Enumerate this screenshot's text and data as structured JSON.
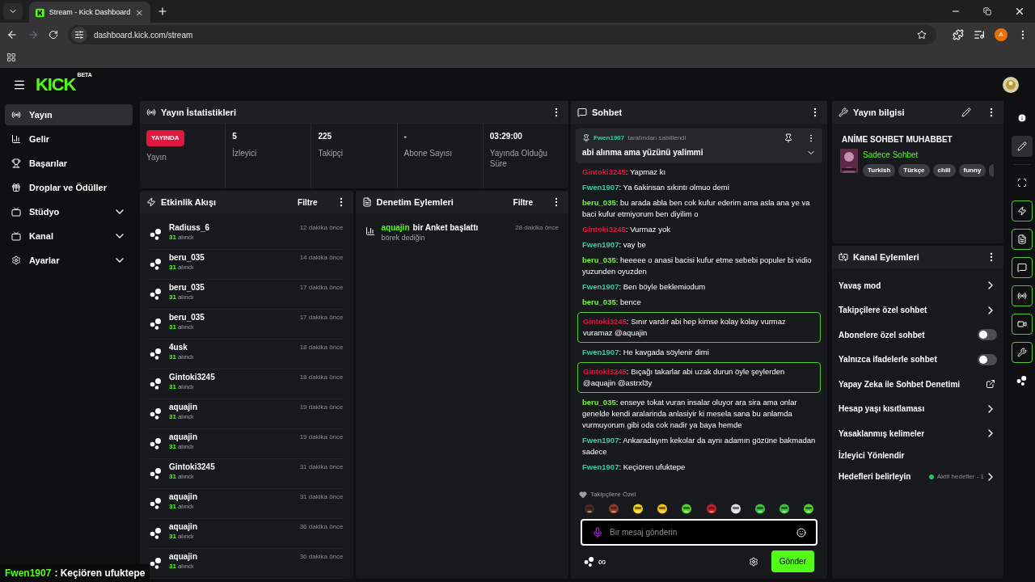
{
  "browser": {
    "tab_title": "Stream - Kick Dashboard",
    "url": "dashboard.kick.com/stream",
    "profile_initial": "A"
  },
  "header": {
    "logo": "KICK",
    "logo_badge": "BETA"
  },
  "sidebar": {
    "items": [
      {
        "label": "Yayın",
        "selected": true,
        "kind": "link"
      },
      {
        "label": "Gelir",
        "selected": false,
        "kind": "link"
      },
      {
        "label": "Başarılar",
        "selected": false,
        "kind": "link"
      },
      {
        "label": "Droplar ve Ödüller",
        "selected": false,
        "kind": "link"
      },
      {
        "label": "Stüdyo",
        "selected": false,
        "kind": "group"
      },
      {
        "label": "Kanal",
        "selected": false,
        "kind": "group"
      },
      {
        "label": "Ayarlar",
        "selected": false,
        "kind": "group"
      }
    ]
  },
  "stats": {
    "title": "Yayın İstatistikleri",
    "items": [
      {
        "kind": "badge",
        "value": "YAYINDA",
        "label": "Yayın"
      },
      {
        "kind": "value",
        "value": "5",
        "label": "İzleyici"
      },
      {
        "kind": "value",
        "value": "225",
        "label": "Takipçi"
      },
      {
        "kind": "value",
        "value": "-",
        "label": "Abone Sayısı"
      },
      {
        "kind": "value",
        "value": "03:29:00",
        "label": "Yayında Olduğu Süre"
      }
    ]
  },
  "events": {
    "title": "Etkinlik Akışı",
    "filter": "Filtre",
    "items": [
      {
        "name": "Radiuss_6",
        "amount": "31",
        "action": "alındı",
        "time": "12 dakika önce"
      },
      {
        "name": "beru_035",
        "amount": "31",
        "action": "alındı",
        "time": "14 dakika önce"
      },
      {
        "name": "beru_035",
        "amount": "31",
        "action": "alındı",
        "time": "17 dakika önce"
      },
      {
        "name": "beru_035",
        "amount": "31",
        "action": "alındı",
        "time": "17 dakika önce"
      },
      {
        "name": "4usk",
        "amount": "31",
        "action": "alındı",
        "time": "18 dakika önce"
      },
      {
        "name": "Gintoki3245",
        "amount": "31",
        "action": "alındı",
        "time": "18 dakika önce"
      },
      {
        "name": "aquajin",
        "amount": "31",
        "action": "alındı",
        "time": "19 dakika önce"
      },
      {
        "name": "aquajin",
        "amount": "31",
        "action": "alındı",
        "time": "19 dakika önce"
      },
      {
        "name": "Gintoki3245",
        "amount": "31",
        "action": "alındı",
        "time": "31 dakika önce"
      },
      {
        "name": "aquajin",
        "amount": "31",
        "action": "alındı",
        "time": "31 dakika önce"
      },
      {
        "name": "aquajin",
        "amount": "31",
        "action": "alındı",
        "time": "36 dakika önce"
      },
      {
        "name": "aquajin",
        "amount": "31",
        "action": "alındı",
        "time": "36 dakika önce"
      }
    ]
  },
  "moderation": {
    "title": "Denetim Eylemleri",
    "filter": "Filtre",
    "items": [
      {
        "user": "aquajin",
        "action": "bir Anket başlattı",
        "detail": "börek dediğin",
        "time": "28 dakika önce"
      }
    ]
  },
  "chat": {
    "title": "Sohbet",
    "pinned": {
      "user": "Fwen1907",
      "by": "tarafından sabitlendi",
      "message": "abi alınma ama yüzünü yalimmi"
    },
    "messages": [
      {
        "user": "Gintoki3245",
        "color": "#e0173f",
        "separator": ":",
        "text": "Yapmaz kı",
        "highlighted": false
      },
      {
        "user": "Fwen1907",
        "color": "#3ec9a7",
        "separator": ":",
        "text": "Ya 6akinsan sıkıntı olmuo demi",
        "highlighted": false
      },
      {
        "user": "beru_035",
        "color": "#72f53a",
        "separator": ":",
        "text": "bu arada abla ben cok kufur ederim ama asla ana ye va baci kufur etmiyorum ben diyilim o",
        "highlighted": false
      },
      {
        "user": "Gintoki3245",
        "color": "#e0173f",
        "separator": ":",
        "text": "Vurmaz yok",
        "highlighted": false
      },
      {
        "user": "Fwen1907",
        "color": "#3ec9a7",
        "separator": ":",
        "text": "vay be",
        "highlighted": false
      },
      {
        "user": "beru_035",
        "color": "#72f53a",
        "separator": ":",
        "text": "heeeee o anasi bacisi kufur etme sebebi populer bi vidio yuzunden oyuzden",
        "highlighted": false
      },
      {
        "user": "Fwen1907",
        "color": "#3ec9a7",
        "separator": ":",
        "text": "Ben böyle beklemiodum",
        "highlighted": false
      },
      {
        "user": "beru_035",
        "color": "#72f53a",
        "separator": ":",
        "text": "bence",
        "highlighted": false
      },
      {
        "user": "Gintoki3245",
        "color": "#e0173f",
        "separator": ":",
        "text": "Sınır vardır abi hep kimse kolay kolay vurmaz vuramaz @aquajin",
        "highlighted": true
      },
      {
        "user": "Fwen1907",
        "color": "#3ec9a7",
        "separator": ":",
        "text": "He kavgada söylenir dimi",
        "highlighted": false
      },
      {
        "user": "Gintoki3245",
        "color": "#e0173f",
        "separator": ":",
        "text": "Bıçağı takarlar abi uzak durun öyle şeylerden @aquajin @astrxl3y",
        "highlighted": true
      },
      {
        "user": "beru_035",
        "color": "#72f53a",
        "separator": ":",
        "text": "enseye tokat vuran insalar oluyor ara sira ama onlar genelde kendi aralarinda anlasiyir ki mesela sana bu anlamda vurmuyorum gibi oda cok nadir ya baya hemde",
        "highlighted": false
      },
      {
        "user": "Fwen1907",
        "color": "#3ec9a7",
        "separator": ":",
        "text": "Ankaradayım kekolar da aynı adamın gözüne bakmadan sadece",
        "highlighted": false
      },
      {
        "user": "Fwen1907",
        "color": "#3ec9a7",
        "separator": ":",
        "text": "Keçiören ufuktepe",
        "highlighted": false
      }
    ],
    "emote_section": "Takipçilere Özel",
    "input_placeholder": "Bir mesaj gönderin",
    "send": "Gönder",
    "points": "∞"
  },
  "stream_info": {
    "title": "Yayın bilgisi",
    "stream_title": "ANİME SOHBET MUHABBET",
    "category": "Sadece Sohbet",
    "tags": [
      "Turkish",
      "Türkçe",
      "chill",
      "funny"
    ]
  },
  "channel_actions": {
    "title": "Kanal Eylemleri",
    "items": [
      {
        "label": "Yavaş mod",
        "kind": "arrow"
      },
      {
        "label": "Takipçilere özel sohbet",
        "kind": "arrow"
      },
      {
        "label": "Abonelere özel sohbet",
        "kind": "toggle",
        "on": false
      },
      {
        "label": "Yalnızca ifadelerle sohbet",
        "kind": "toggle",
        "on": false
      },
      {
        "label": "Yapay Zeka ile Sohbet Denetimi",
        "kind": "external"
      },
      {
        "label": "Hesap yaşı kısıtlaması",
        "kind": "arrow"
      },
      {
        "label": "Yasaklanmış kelimeler",
        "kind": "arrow"
      },
      {
        "label": "İzleyici Yönlendir",
        "kind": "plain"
      },
      {
        "label": "Hedefleri belirleyin",
        "kind": "goal",
        "status": "Aktif hedefler - 1",
        "color": "#22c55e"
      }
    ]
  },
  "rail": [
    {
      "selected": false,
      "outlined": false
    },
    {
      "selected": true,
      "outlined": false
    },
    {
      "selected": false,
      "outlined": false
    },
    {
      "selected": false,
      "outlined": true
    },
    {
      "selected": false,
      "outlined": true
    },
    {
      "selected": false,
      "outlined": true
    },
    {
      "selected": false,
      "outlined": true
    },
    {
      "selected": false,
      "outlined": true
    },
    {
      "selected": false,
      "outlined": true
    },
    {
      "selected": false,
      "outlined": false
    }
  ],
  "overlay": {
    "user": "Fwen1907",
    "text": ": Keçiören ufuktepe"
  }
}
